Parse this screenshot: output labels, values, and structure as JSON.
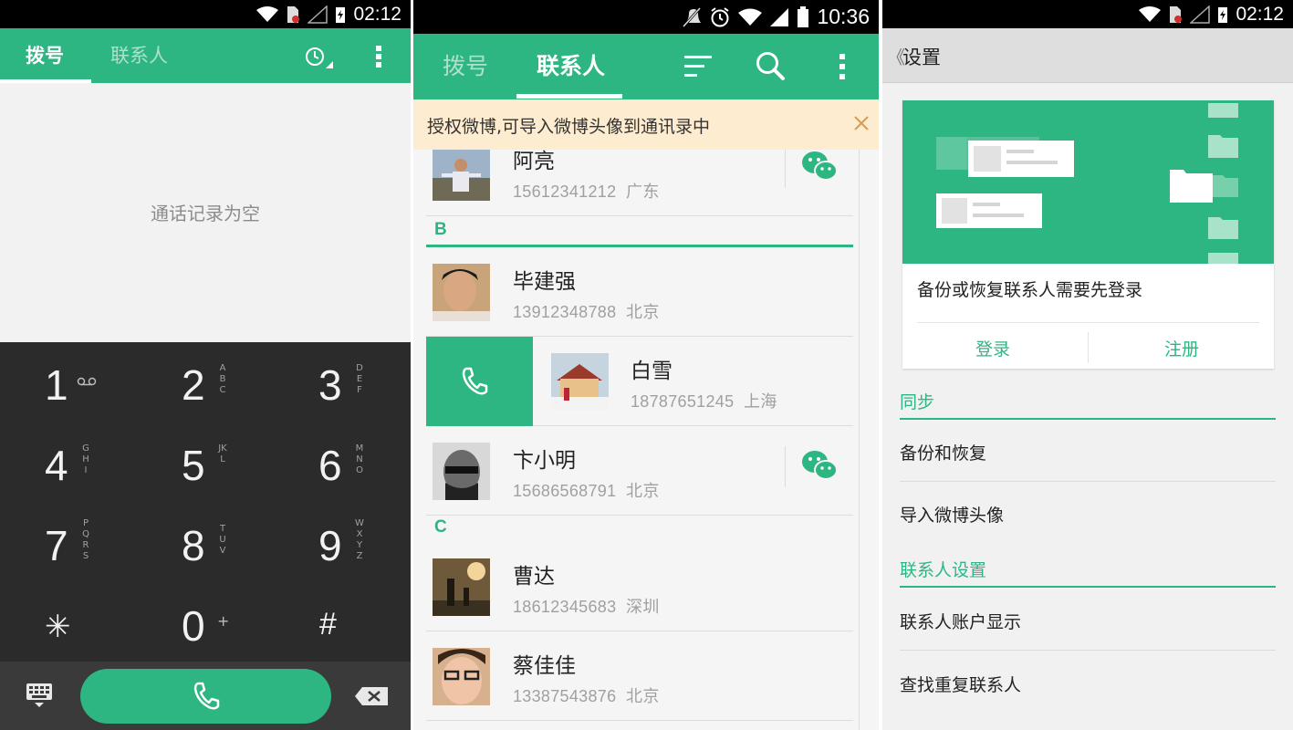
{
  "dialer_screen": {
    "status": {
      "time": "02:12"
    },
    "tabs": [
      "拨号",
      "联系人"
    ],
    "empty_message": "通话记录为空",
    "keys": [
      {
        "digit": "1",
        "letters": "",
        "sub": "voicemail"
      },
      {
        "digit": "2",
        "letters": "ABC"
      },
      {
        "digit": "3",
        "letters": "DEF"
      },
      {
        "digit": "4",
        "letters": "GHI"
      },
      {
        "digit": "5",
        "letters": "JKL"
      },
      {
        "digit": "6",
        "letters": "MNO"
      },
      {
        "digit": "7",
        "letters": "PQRS"
      },
      {
        "digit": "8",
        "letters": "TUV"
      },
      {
        "digit": "9",
        "letters": "WXYZ"
      },
      {
        "digit": "✳",
        "letters": ""
      },
      {
        "digit": "0",
        "letters": "",
        "sub": "+"
      },
      {
        "digit": "#",
        "letters": ""
      }
    ],
    "icons": [
      "history-icon",
      "overflow-menu-icon",
      "dialpad-keyboard-icon",
      "phone-icon",
      "backspace-icon"
    ],
    "accent": "#2db582"
  },
  "contacts_screen": {
    "status": {
      "time": "10:36"
    },
    "tabs": [
      "拨号",
      "联系人"
    ],
    "banner": "授权微博,可导入微博头像到通讯录中",
    "sections": {
      "b": "B",
      "c": "C"
    },
    "contacts": [
      {
        "name": "阿亮",
        "phone": "15612341212",
        "city": "广东",
        "wechat": true
      },
      {
        "name": "毕建强",
        "phone": "13912348788",
        "city": "北京",
        "wechat": false
      },
      {
        "name": "白雪",
        "phone": "18787651245",
        "city": "上海",
        "wechat": false
      },
      {
        "name": "卞小明",
        "phone": "15686568791",
        "city": "北京",
        "wechat": true
      },
      {
        "name": "曹达",
        "phone": "18612345683",
        "city": "深圳",
        "wechat": false
      },
      {
        "name": "蔡佳佳",
        "phone": "13387543876",
        "city": "北京",
        "wechat": false
      }
    ],
    "icons": [
      "sort-icon",
      "search-icon",
      "overflow-menu-icon",
      "close-icon",
      "wechat-icon",
      "phone-icon"
    ]
  },
  "settings_screen": {
    "status": {
      "time": "02:12"
    },
    "back": "《",
    "title": "设置",
    "card": {
      "message": "备份或恢复联系人需要先登录",
      "login": "登录",
      "register": "注册"
    },
    "sections": [
      {
        "title": "同步",
        "items": [
          "备份和恢复",
          "导入微博头像"
        ]
      },
      {
        "title": "联系人设置",
        "items": [
          "联系人账户显示",
          "查找重复联系人"
        ]
      }
    ]
  }
}
